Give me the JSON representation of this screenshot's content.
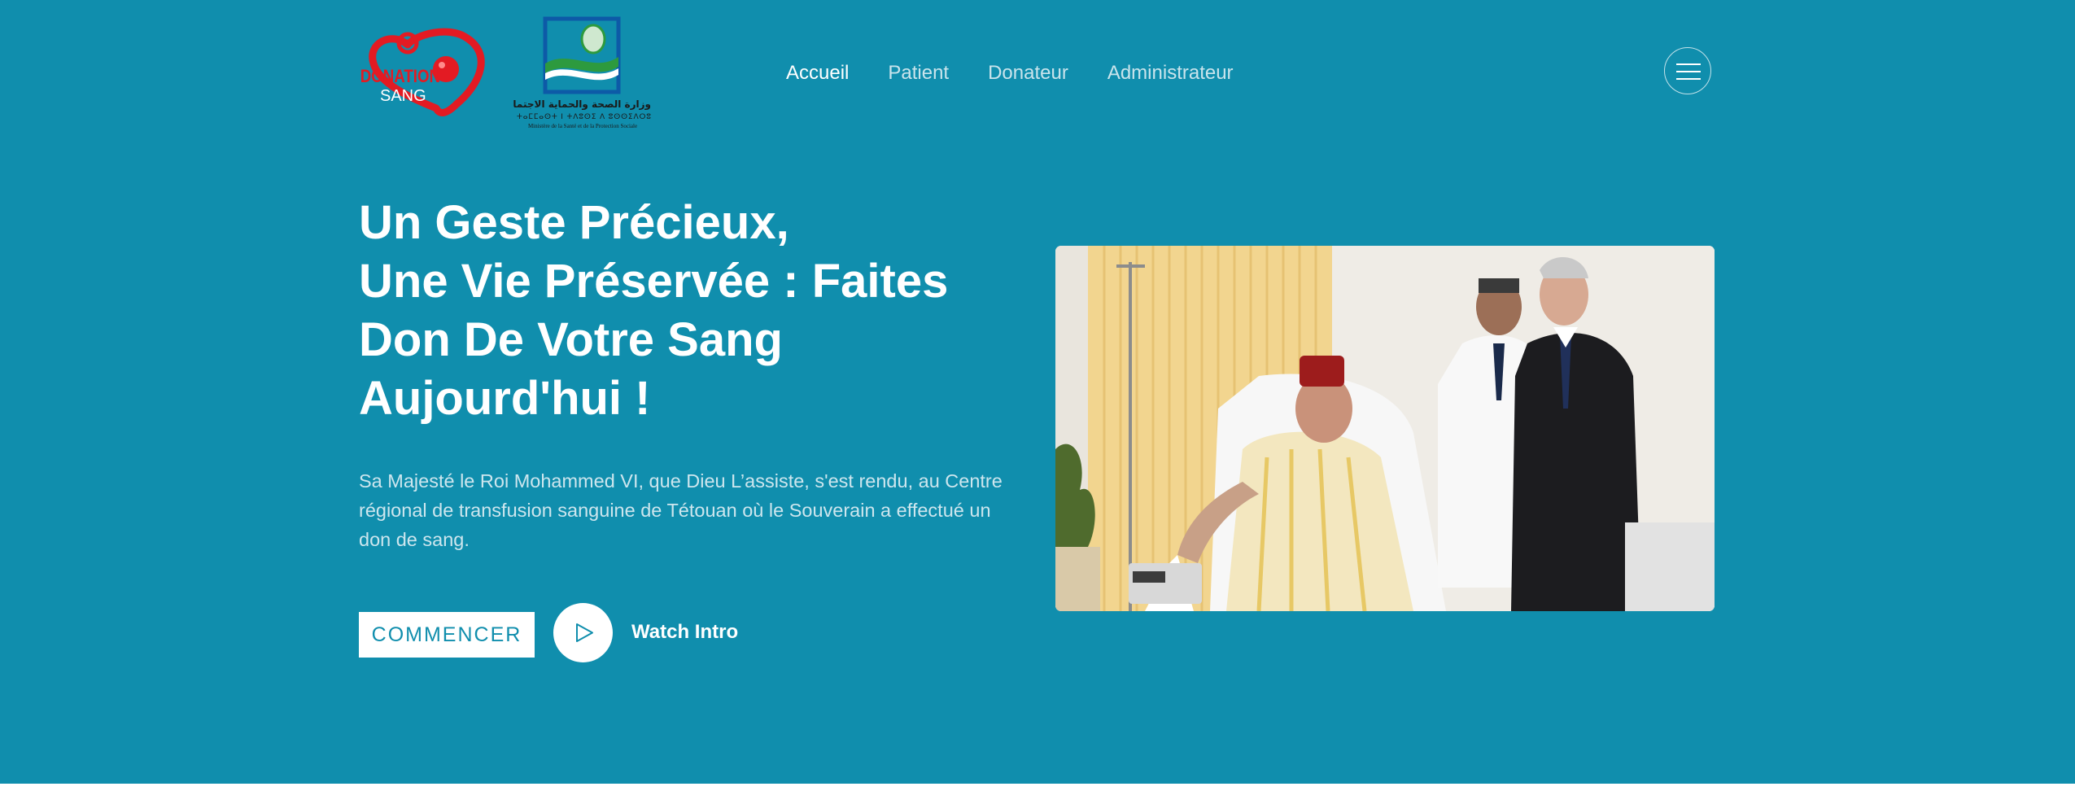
{
  "header": {
    "logo_donation": {
      "word1": "DONATION",
      "word2": "SANG"
    },
    "logo_ministry": {
      "arabic": "وزارة الصحة والحماية الاجتماعية",
      "tifinagh": "ⵜⴰⵎⵎⴰⵙⵜ ⵏ ⵜⴷⵓⵙⵉ ⴷ ⵓⵙⵙⵉⴷⵔⵓ",
      "french": "Ministère de la Santé et de la Protection Sociale"
    },
    "nav": [
      {
        "label": "Accueil",
        "active": true
      },
      {
        "label": "Patient",
        "active": false
      },
      {
        "label": "Donateur",
        "active": false
      },
      {
        "label": "Administrateur",
        "active": false
      }
    ],
    "menu_icon": "hamburger-icon"
  },
  "hero": {
    "title_lines": [
      "Un Geste Précieux,",
      "Une Vie Préservée : Faites",
      "Don De Votre Sang",
      "Aujourd'hui !"
    ],
    "description": "Sa Majesté le Roi Mohammed VI, que Dieu L’assiste, s'est rendu, au Centre régional de transfusion sanguine de Tétouan où le Souverain a effectué un don de sang.",
    "cta_label": "COMMENCER",
    "play_icon": "play-icon",
    "watch_label": "Watch Intro"
  },
  "colors": {
    "hero_background": "#108ead",
    "nav_active": "#ffffff",
    "nav_inactive": "#c9e4ec",
    "logo_red": "#e31b23",
    "ministry_blue": "#0d5aa7",
    "ministry_green": "#2d9a3e"
  }
}
